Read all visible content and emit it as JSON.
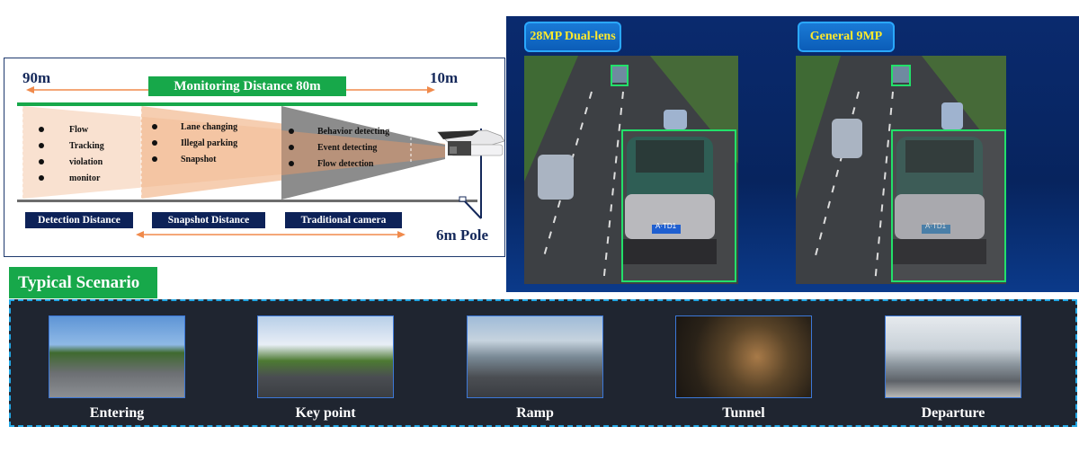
{
  "diagram": {
    "far_distance": "90m",
    "near_distance": "10m",
    "monitoring_label": "Monitoring Distance 80m",
    "pole_label": "6m Pole",
    "zones": [
      {
        "tag": "Detection Distance",
        "items": [
          "Flow",
          "Tracking",
          "violation",
          "monitor"
        ]
      },
      {
        "tag": "Snapshot Distance",
        "items": [
          "Lane changing",
          "Illegal parking",
          "Snapshot"
        ]
      },
      {
        "tag": "Traditional camera",
        "items": [
          "Behavior detecting",
          "Event detecting",
          "Flow detection"
        ]
      }
    ],
    "colors": {
      "green": "#17a84a",
      "navy": "#0d2258",
      "orange": "#f08a4b"
    }
  },
  "comparison": {
    "panels": [
      {
        "label": "28MP Dual-lens",
        "plate": "A·TD1"
      },
      {
        "label": "General 9MP",
        "plate": "A·TD1"
      }
    ],
    "colors": {
      "tag_text": "#ffea2b",
      "highlight": "#22e06a"
    }
  },
  "scenarios": {
    "title": "Typical Scenario",
    "items": [
      {
        "label": "Entering"
      },
      {
        "label": "Key point"
      },
      {
        "label": "Ramp"
      },
      {
        "label": "Tunnel"
      },
      {
        "label": "Departure"
      }
    ]
  }
}
